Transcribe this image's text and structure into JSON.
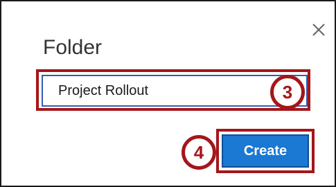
{
  "dialog": {
    "title": "Folder",
    "close_icon": "close-icon",
    "name_input": {
      "value": "Project Rollout"
    },
    "create_label": "Create"
  },
  "annotations": {
    "step_input": "3",
    "step_button": "4"
  },
  "colors": {
    "accent": "#1b78d3",
    "callout": "#a4161a",
    "input_border": "#2f5fb3"
  }
}
